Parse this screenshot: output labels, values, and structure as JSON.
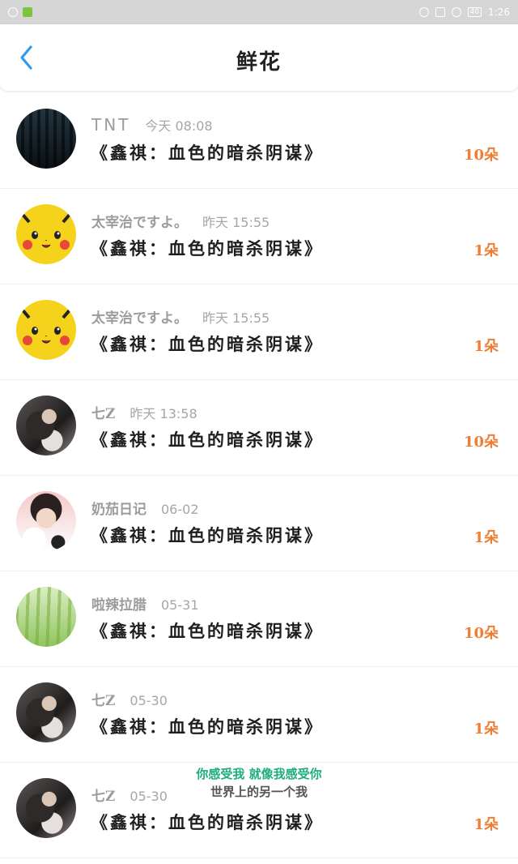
{
  "status_bar": {
    "time": "1:26",
    "battery": "40"
  },
  "header": {
    "title": "鲜花"
  },
  "items": [
    {
      "username": "TNT",
      "time": "今天 08:08",
      "title": "《鑫祺：血色的暗杀阴谋》",
      "count": "10朵",
      "avatar": "group"
    },
    {
      "username": "太宰治ですよ。",
      "time": "昨天 15:55",
      "title": "《鑫祺：血色的暗杀阴谋》",
      "count": "1朵",
      "avatar": "pikachu"
    },
    {
      "username": "太宰治ですよ。",
      "time": "昨天 15:55",
      "title": "《鑫祺：血色的暗杀阴谋》",
      "count": "1朵",
      "avatar": "pikachu"
    },
    {
      "username": "七Z",
      "time": "昨天 13:58",
      "title": "《鑫祺：血色的暗杀阴谋》",
      "count": "10朵",
      "avatar": "photo-dark"
    },
    {
      "username": "奶茄日记",
      "time": "06-02",
      "title": "《鑫祺：血色的暗杀阴谋》",
      "count": "1朵",
      "avatar": "cat-boy"
    },
    {
      "username": "啦辣拉腊",
      "time": "05-31",
      "title": "《鑫祺：血色的暗杀阴谋》",
      "count": "10朵",
      "avatar": "bamboo"
    },
    {
      "username": "七Z",
      "time": "05-30",
      "title": "《鑫祺：血色的暗杀阴谋》",
      "count": "1朵",
      "avatar": "photo-dark"
    },
    {
      "username": "七Z",
      "time": "05-30",
      "title": "《鑫祺：血色的暗杀阴谋》",
      "count": "1朵",
      "avatar": "photo-dark"
    }
  ],
  "subtitles": {
    "line1": "你感受我 就像我感受你",
    "line2": "世界上的另一个我"
  },
  "colors": {
    "accent_count": "#ef7d33",
    "back_arrow": "#2f9bef"
  }
}
